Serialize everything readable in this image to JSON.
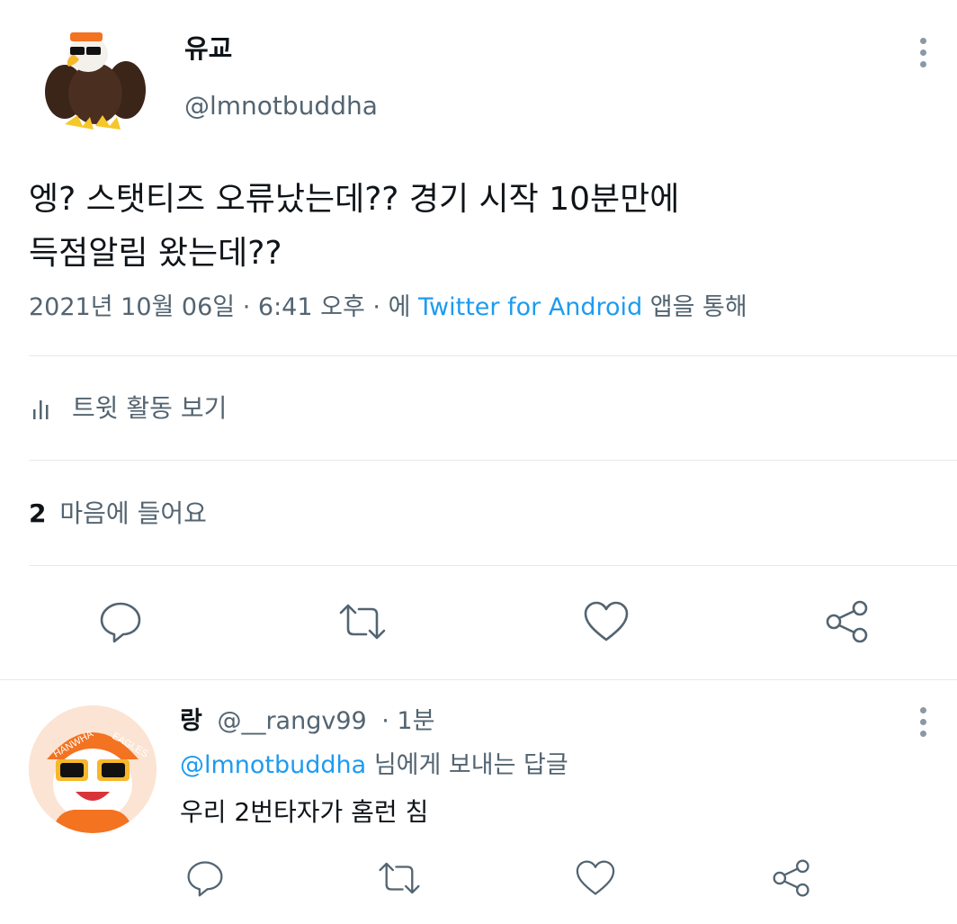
{
  "tweet": {
    "author_name": "유교",
    "author_handle": "@lmnotbuddha",
    "text_line1": "엥? 스탯티즈 오류났는데?? 경기 시작 10분만에",
    "text_line2": "득점알림 왔는데??",
    "date": "2021년 10월 06일",
    "sep1": "·",
    "time": "6:41 오후",
    "sep2": "·",
    "via_prefix": "에",
    "via_app": "Twitter for Android",
    "via_suffix": "앱을 통해",
    "activity_label": "트윗 활동 보기",
    "likes_count": "2",
    "likes_label": "마음에 들어요"
  },
  "reply": {
    "author_name": "랑",
    "author_handle": "@__rangv99",
    "age": "· 1분",
    "replying_to": "@lmnotbuddha",
    "replying_suffix": "님에게 보내는 답글",
    "text": "우리 2번타자가 홈런 침",
    "avatar_text_left": "HANWHA",
    "avatar_text_right": "EAGLES"
  },
  "icons": [
    "more-icon",
    "activity-icon",
    "reply-icon",
    "retweet-icon",
    "like-icon",
    "share-icon"
  ],
  "colors": {
    "link": "#1d9bf0",
    "muted": "#536471",
    "divider": "#e7e9ea",
    "orange": "#f37321"
  }
}
